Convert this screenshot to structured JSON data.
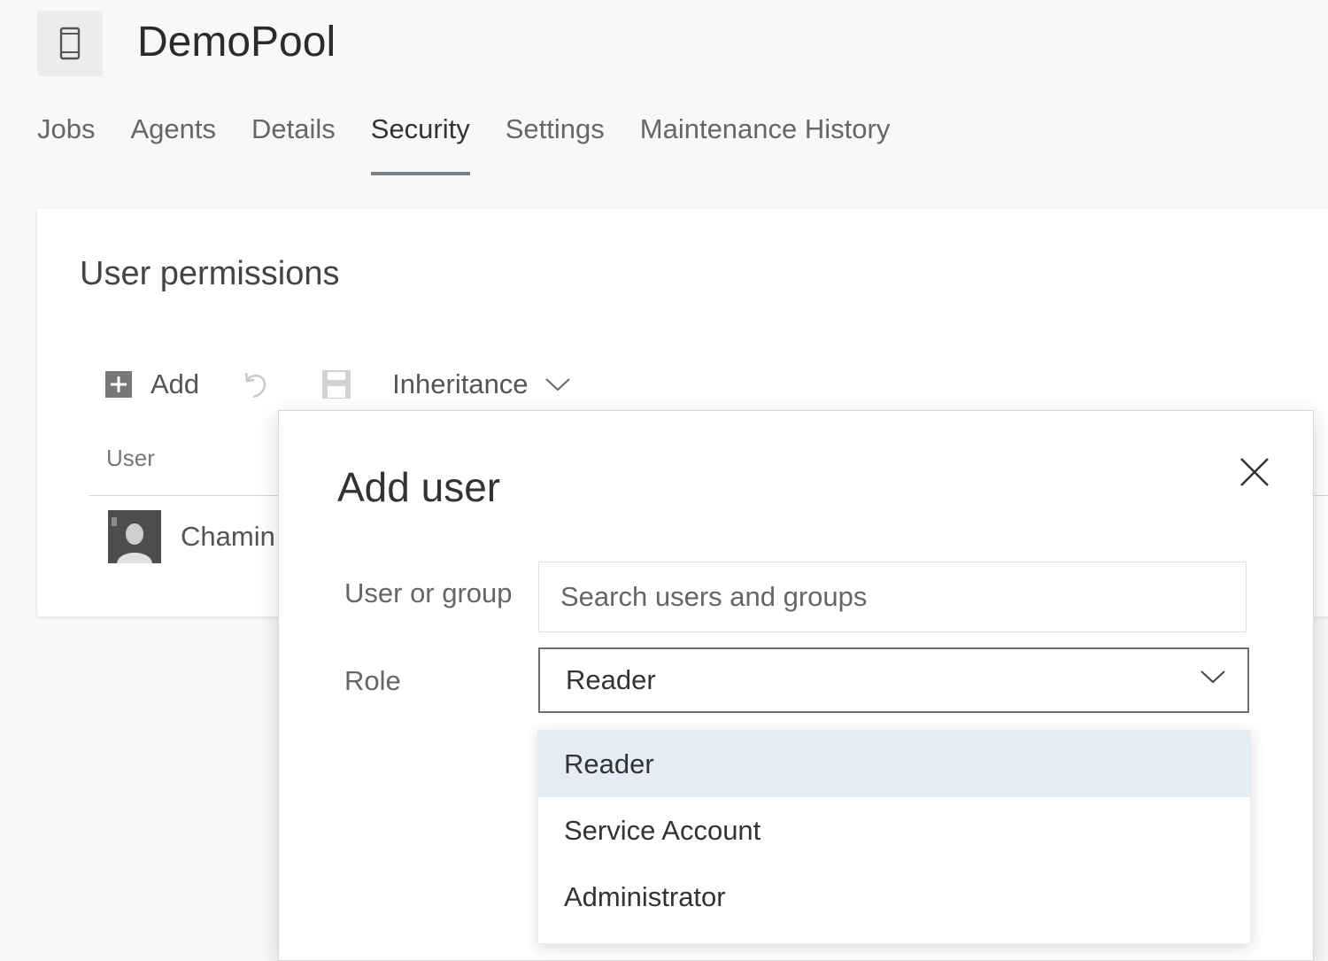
{
  "header": {
    "pool_icon": "mobile-device-icon",
    "title": "DemoPool"
  },
  "tabs": [
    {
      "label": "Jobs"
    },
    {
      "label": "Agents"
    },
    {
      "label": "Details"
    },
    {
      "label": "Security"
    },
    {
      "label": "Settings"
    },
    {
      "label": "Maintenance History"
    }
  ],
  "active_tab": "Security",
  "permissions": {
    "title": "User permissions",
    "toolbar": {
      "add_label": "Add",
      "add_icon": "plus-square-icon",
      "undo_icon": "undo-icon",
      "save_icon": "save-icon",
      "inheritance_label": "Inheritance",
      "inheritance_icon": "chevron-down-icon"
    },
    "column_user": "User",
    "users": [
      {
        "name": "Chamin",
        "avatar": "avatar"
      }
    ]
  },
  "dialog": {
    "title": "Add user",
    "close_icon": "close-icon",
    "user_label": "User or group",
    "search_placeholder": "Search users and groups",
    "role_label": "Role",
    "role_value": "Reader",
    "role_options": [
      "Reader",
      "Service Account",
      "Administrator"
    ],
    "selected_option": "Reader"
  },
  "colors": {
    "page_bg": "#f8f8f8",
    "card_bg": "#ffffff",
    "tab_underline": "#7a7f86",
    "option_highlight": "#e5ecf5",
    "select_border": "#6e6e6e"
  }
}
